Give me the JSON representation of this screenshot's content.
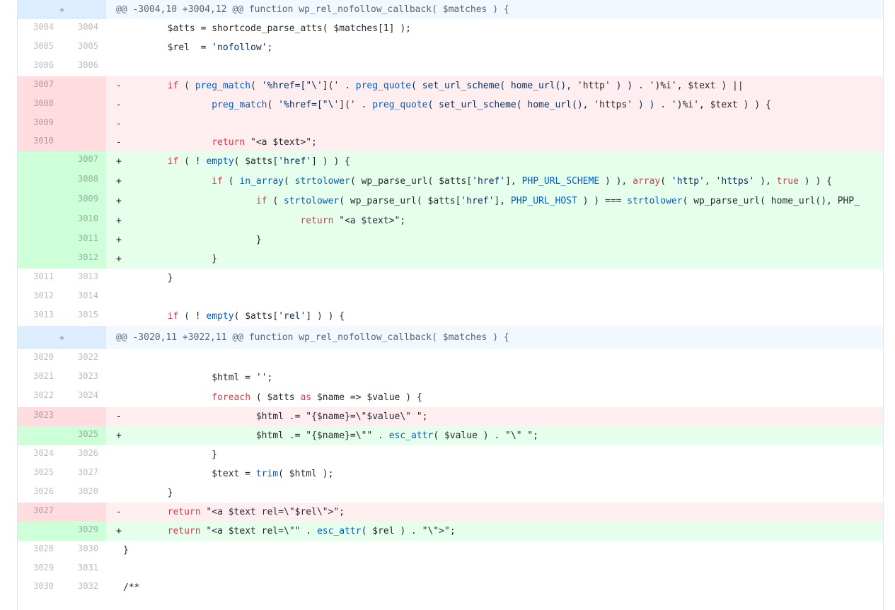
{
  "hunks": [
    {
      "header": "@@ -3004,10 +3004,12 @@ function wp_rel_nofollow_callback( $matches ) {"
    },
    {
      "header": "@@ -3020,11 +3022,11 @@ function wp_rel_nofollow_callback( $matches ) {"
    }
  ],
  "lines": [
    {
      "old": "3004",
      "new": "3004",
      "type": " ",
      "code": "\t$atts = shortcode_parse_atts( $matches[1] );"
    },
    {
      "old": "3005",
      "new": "3005",
      "type": " ",
      "code": "\t$rel  = 'nofollow';"
    },
    {
      "old": "3006",
      "new": "3006",
      "type": " ",
      "code": ""
    },
    {
      "old": "3007",
      "new": "",
      "type": "-",
      "code": "\tif ( preg_match( '%href=[\"\\'](' . preg_quote( set_url_scheme( home_url(), 'http' ) ) . ')%i', $text ) ||"
    },
    {
      "old": "3008",
      "new": "",
      "type": "-",
      "code": "\t\tpreg_match( '%href=[\"\\'](' . preg_quote( set_url_scheme( home_url(), 'https' ) ) . ')%i', $text ) ) {"
    },
    {
      "old": "3009",
      "new": "",
      "type": "-",
      "code": ""
    },
    {
      "old": "3010",
      "new": "",
      "type": "-",
      "code": "\t\treturn \"<a $text>\";"
    },
    {
      "old": "",
      "new": "3007",
      "type": "+",
      "code": "\tif ( ! empty( $atts['href'] ) ) {"
    },
    {
      "old": "",
      "new": "3008",
      "type": "+",
      "code": "\t\tif ( in_array( strtolower( wp_parse_url( $atts['href'], PHP_URL_SCHEME ) ), array( 'http', 'https' ), true ) ) {"
    },
    {
      "old": "",
      "new": "3009",
      "type": "+",
      "code": "\t\t\tif ( strtolower( wp_parse_url( $atts['href'], PHP_URL_HOST ) ) === strtolower( wp_parse_url( home_url(), PHP_"
    },
    {
      "old": "",
      "new": "3010",
      "type": "+",
      "code": "\t\t\t\treturn \"<a $text>\";"
    },
    {
      "old": "",
      "new": "3011",
      "type": "+",
      "code": "\t\t\t}"
    },
    {
      "old": "",
      "new": "3012",
      "type": "+",
      "code": "\t\t}"
    },
    {
      "old": "3011",
      "new": "3013",
      "type": " ",
      "code": "\t}"
    },
    {
      "old": "3012",
      "new": "3014",
      "type": " ",
      "code": ""
    },
    {
      "old": "3013",
      "new": "3015",
      "type": " ",
      "code": "\tif ( ! empty( $atts['rel'] ) ) {"
    },
    {
      "old": "3020",
      "new": "3022",
      "type": " ",
      "code": ""
    },
    {
      "old": "3021",
      "new": "3023",
      "type": " ",
      "code": "\t\t$html = '';"
    },
    {
      "old": "3022",
      "new": "3024",
      "type": " ",
      "code": "\t\tforeach ( $atts as $name => $value ) {"
    },
    {
      "old": "3023",
      "new": "",
      "type": "-",
      "code": "\t\t\t$html .= \"{$name}=\\\"$value\\\" \";"
    },
    {
      "old": "",
      "new": "3025",
      "type": "+",
      "code": "\t\t\t$html .= \"{$name}=\\\"\" . esc_attr( $value ) . \"\\\" \";"
    },
    {
      "old": "3024",
      "new": "3026",
      "type": " ",
      "code": "\t\t}"
    },
    {
      "old": "3025",
      "new": "3027",
      "type": " ",
      "code": "\t\t$text = trim( $html );"
    },
    {
      "old": "3026",
      "new": "3028",
      "type": " ",
      "code": "\t}"
    },
    {
      "old": "3027",
      "new": "",
      "type": "-",
      "code": "\treturn \"<a $text rel=\\\"$rel\\\">\";"
    },
    {
      "old": "",
      "new": "3029",
      "type": "+",
      "code": "\treturn \"<a $text rel=\\\"\" . esc_attr( $rel ) . \"\\\">\";"
    },
    {
      "old": "3028",
      "new": "3030",
      "type": " ",
      "code": "}"
    },
    {
      "old": "3029",
      "new": "3031",
      "type": " ",
      "code": ""
    },
    {
      "old": "3030",
      "new": "3032",
      "type": " ",
      "code": "/**"
    }
  ],
  "icons": {
    "expand": "expand-icon"
  },
  "colors": {
    "deletion": "#ffeef0",
    "addition": "#e6ffed",
    "hunk": "#f1f8ff"
  }
}
